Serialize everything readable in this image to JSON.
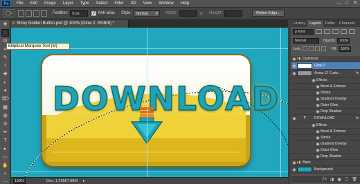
{
  "app": {
    "logo": "Ps"
  },
  "menu": [
    "File",
    "Edit",
    "Image",
    "Layer",
    "Type",
    "Select",
    "Filter",
    "3D",
    "View",
    "Window",
    "Help"
  ],
  "window_controls": [
    "—",
    "□",
    "✕"
  ],
  "options": {
    "feather_label": "Feather:",
    "feather_value": "0 px",
    "antialias_label": "Anti-alias",
    "antialias_check": "✓",
    "style_label": "Style:",
    "style_value": "Normal",
    "width_label": "Width:",
    "height_label": "Height:",
    "refine_label": "Refine Edge..."
  },
  "tools": [
    "✥",
    "◌",
    "ʘ",
    "⌗",
    "✎",
    "⟟",
    "✚",
    "◐",
    "✦",
    "⌦",
    "▦",
    "◍",
    "⊘",
    "✒",
    "T",
    "▸",
    "▭",
    "✋",
    "⌕",
    "⋯"
  ],
  "document": {
    "tab_title": "Shiny Golden Button.psd @ 100% (Glow 2, RGB/8) *",
    "close_glyph": "✕"
  },
  "canvas": {
    "headline": "DOWNLOAD"
  },
  "tooltip": "Elliptical Marquee Tool (M)",
  "status": {
    "zoom": "100%",
    "doc": "Doc: 1.29M/7.88M",
    "arrow": "▸"
  },
  "panel_tabs": [
    "History",
    "Layers",
    "Paths",
    "Channels"
  ],
  "layer_filter": {
    "kind": "ρ Kind"
  },
  "blend": {
    "mode": "Normal",
    "opacity_label": "Opacity:",
    "opacity_value": "100%"
  },
  "lock": {
    "label": "Lock:",
    "fill_label": "Fill:",
    "fill_value": "100%"
  },
  "layers": [
    {
      "name": "Download",
      "eye": "◉"
    },
    {
      "name": "Glow 2",
      "eye": "◉"
    },
    {
      "name": "Arrow 12 Custo...",
      "eye": "◉",
      "fx": "fx"
    },
    {
      "name": "Effects",
      "eye": "◉"
    },
    {
      "name": "Bevel & Emboss",
      "eye": "◉"
    },
    {
      "name": "Stroke",
      "eye": "◉"
    },
    {
      "name": "Gradient Overlay",
      "eye": "◉"
    },
    {
      "name": "Outer Glow",
      "eye": "◉"
    },
    {
      "name": "Drop Shadow",
      "eye": "◉"
    },
    {
      "name": "DOWNLOAD",
      "eye": "◉",
      "fx": "fx",
      "glyph": "T"
    },
    {
      "name": "Effects",
      "eye": "◉"
    },
    {
      "name": "Bevel & Emboss",
      "eye": "◉"
    },
    {
      "name": "Stroke",
      "eye": "◉"
    },
    {
      "name": "Gradient Overlay",
      "eye": "◉"
    },
    {
      "name": "Outer Glow",
      "eye": "◉"
    },
    {
      "name": "Drop Shadow",
      "eye": "◉"
    },
    {
      "name": "Base",
      "eye": "◉"
    },
    {
      "name": "Background",
      "eye": "◉"
    }
  ],
  "layer_footer": [
    "ƒx",
    "◨",
    "▣",
    "☐",
    "🗑"
  ],
  "colors": {
    "canvas": "#20a6bd",
    "selected_layer": "#4e81b8",
    "text": "#1fa3b5"
  }
}
